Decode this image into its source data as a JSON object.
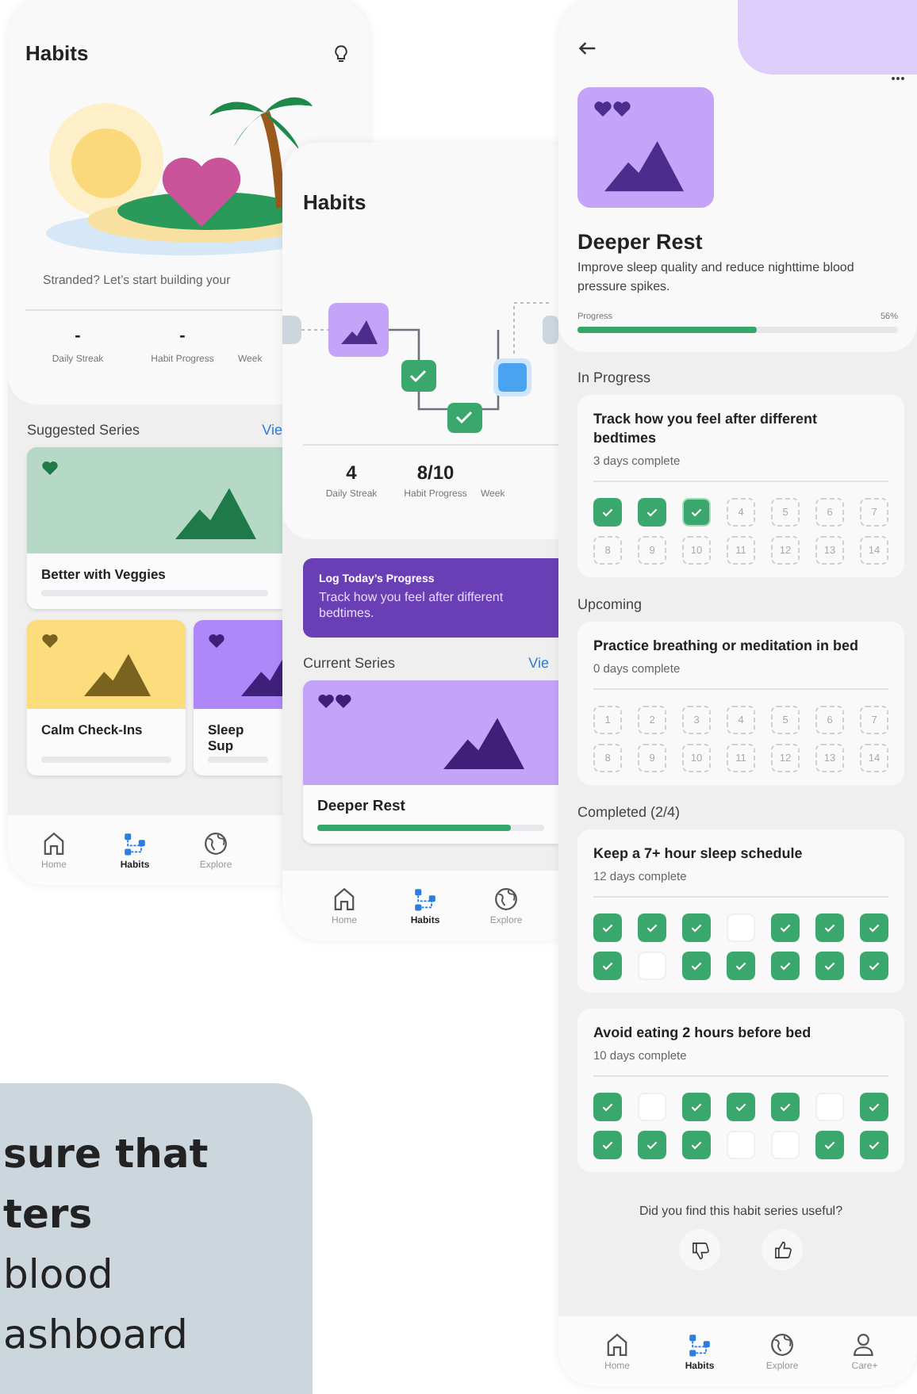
{
  "callout": {
    "lines": [
      "sure that",
      "ters",
      "blood",
      "ashboard"
    ]
  },
  "home_screen": {
    "title": "Habits",
    "message": "Stranded? Let’s start building your",
    "stats": [
      {
        "value": "-",
        "label": "Daily Streak"
      },
      {
        "value": "-",
        "label": "Habit Progress"
      },
      {
        "label": "Week"
      }
    ],
    "suggested": {
      "heading": "Suggested Series",
      "link": "Vie",
      "cards": [
        {
          "title": "Better with Veggies",
          "color": "#b5d9c6"
        },
        {
          "title": "Calm Check-Ins",
          "color": "#fcdc7c"
        },
        {
          "title": "Sleep Sup",
          "color": "#ae87f8"
        }
      ]
    },
    "nav": [
      {
        "label": "Home",
        "selected": false
      },
      {
        "label": "Habits",
        "selected": true
      },
      {
        "label": "Explore",
        "selected": false
      }
    ]
  },
  "path_screen": {
    "title": "Habits",
    "stats": [
      {
        "value": "4",
        "label": "Daily Streak"
      },
      {
        "value": "8/10",
        "label": "Habit Progress"
      },
      {
        "label": "Week"
      }
    ],
    "banner": {
      "title": "Log Today’s Progress",
      "text": "Track how you feel after different bedtimes."
    },
    "current": {
      "heading": "Current Series",
      "link": "Vie",
      "card": {
        "title": "Deeper Rest",
        "color": "#c3a4f8",
        "level": 0.85
      }
    },
    "nav": [
      {
        "label": "Home",
        "selected": false
      },
      {
        "label": "Habits",
        "selected": true
      },
      {
        "label": "Explore",
        "selected": false
      }
    ]
  },
  "detail_screen": {
    "title": "Deeper Rest",
    "description": "Improve sleep quality and reduce nighttime blood pressure spikes.",
    "progress": {
      "label": "Progress",
      "reading": "56%",
      "level": 0.56
    },
    "sections": [
      {
        "heading": "In Progress",
        "habits": [
          {
            "title": "Track how you feel after different bedtimes",
            "summary": "3 days complete",
            "days": [
              {
                "kind": "done"
              },
              {
                "kind": "done"
              },
              {
                "kind": "current"
              },
              {
                "kind": "pending",
                "label": "4"
              },
              {
                "kind": "pending",
                "label": "5"
              },
              {
                "kind": "pending",
                "label": "6"
              },
              {
                "kind": "pending",
                "label": "7"
              },
              {
                "kind": "pending",
                "label": "8"
              },
              {
                "kind": "pending",
                "label": "9"
              },
              {
                "kind": "pending",
                "label": "10"
              },
              {
                "kind": "pending",
                "label": "11"
              },
              {
                "kind": "pending",
                "label": "12"
              },
              {
                "kind": "pending",
                "label": "13"
              },
              {
                "kind": "pending",
                "label": "14"
              }
            ]
          }
        ]
      },
      {
        "heading": "Upcoming",
        "habits": [
          {
            "title": "Practice breathing or meditation in bed",
            "summary": "0 days complete",
            "days": [
              {
                "kind": "pending",
                "label": "1"
              },
              {
                "kind": "pending",
                "label": "2"
              },
              {
                "kind": "pending",
                "label": "3"
              },
              {
                "kind": "pending",
                "label": "4"
              },
              {
                "kind": "pending",
                "label": "5"
              },
              {
                "kind": "pending",
                "label": "6"
              },
              {
                "kind": "pending",
                "label": "7"
              },
              {
                "kind": "pending",
                "label": "8"
              },
              {
                "kind": "pending",
                "label": "9"
              },
              {
                "kind": "pending",
                "label": "10"
              },
              {
                "kind": "pending",
                "label": "11"
              },
              {
                "kind": "pending",
                "label": "12"
              },
              {
                "kind": "pending",
                "label": "13"
              },
              {
                "kind": "pending",
                "label": "14"
              }
            ]
          }
        ]
      },
      {
        "heading": "Completed (2/4)",
        "habits": [
          {
            "title": "Keep a 7+ hour sleep schedule",
            "summary": "12 days complete",
            "days": [
              {
                "kind": "done"
              },
              {
                "kind": "done"
              },
              {
                "kind": "done"
              },
              {
                "kind": "missed"
              },
              {
                "kind": "done"
              },
              {
                "kind": "done"
              },
              {
                "kind": "done"
              },
              {
                "kind": "done"
              },
              {
                "kind": "missed"
              },
              {
                "kind": "done"
              },
              {
                "kind": "done"
              },
              {
                "kind": "done"
              },
              {
                "kind": "done"
              },
              {
                "kind": "done"
              }
            ]
          },
          {
            "title": "Avoid eating 2 hours before bed",
            "summary": "10 days complete",
            "days": [
              {
                "kind": "done"
              },
              {
                "kind": "missed"
              },
              {
                "kind": "done"
              },
              {
                "kind": "done"
              },
              {
                "kind": "done"
              },
              {
                "kind": "missed"
              },
              {
                "kind": "done"
              },
              {
                "kind": "done"
              },
              {
                "kind": "done"
              },
              {
                "kind": "done"
              },
              {
                "kind": "missed"
              },
              {
                "kind": "missed"
              },
              {
                "kind": "done"
              },
              {
                "kind": "done"
              }
            ]
          }
        ]
      }
    ],
    "feedback": {
      "question": "Did you find this habit series useful?"
    },
    "nav": [
      {
        "label": "Home",
        "selected": false
      },
      {
        "label": "Habits",
        "selected": true
      },
      {
        "label": "Explore",
        "selected": false
      },
      {
        "label": "Care+",
        "selected": false
      }
    ]
  }
}
